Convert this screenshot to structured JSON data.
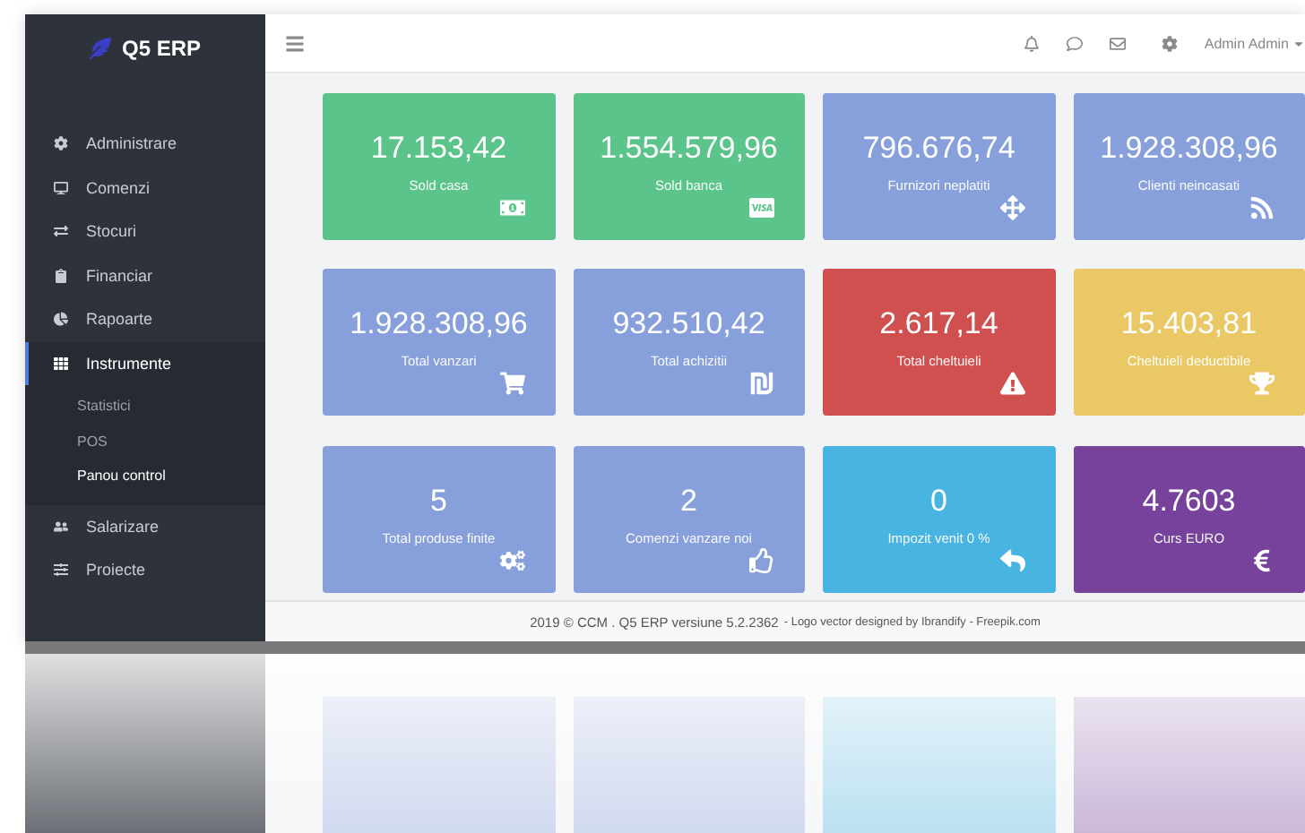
{
  "brand": {
    "name": "Q5 ERP"
  },
  "sidebar": {
    "items": [
      {
        "label": "Administrare",
        "selected": false
      },
      {
        "label": "Comenzi",
        "selected": false
      },
      {
        "label": "Stocuri",
        "selected": false
      },
      {
        "label": "Financiar",
        "selected": false
      },
      {
        "label": "Rapoarte",
        "selected": false
      },
      {
        "label": "Instrumente",
        "selected": true,
        "expanded": true,
        "children": [
          {
            "label": "Statistici",
            "selected": false
          },
          {
            "label": "POS",
            "selected": false
          },
          {
            "label": "Panou control",
            "selected": true
          }
        ]
      },
      {
        "label": "Salarizare",
        "selected": false
      },
      {
        "label": "Proiecte",
        "selected": false
      }
    ]
  },
  "header": {
    "user": "Admin Admin"
  },
  "cards": [
    {
      "value": "17.153,42",
      "label": "Sold casa",
      "color": "#5bc48a"
    },
    {
      "value": "1.554.579,96",
      "label": "Sold banca",
      "color": "#5bc48a"
    },
    {
      "value": "796.676,74",
      "label": "Furnizori neplatiti",
      "color": "#87a0dc"
    },
    {
      "value": "1.928.308,96",
      "label": "Clienti neincasati",
      "color": "#87a0dc"
    },
    {
      "value": "1.928.308,96",
      "label": "Total vanzari",
      "color": "#87a0dc"
    },
    {
      "value": "932.510,42",
      "label": "Total achizitii",
      "color": "#87a0dc"
    },
    {
      "value": "2.617,14",
      "label": "Total cheltuieli",
      "color": "#d05050"
    },
    {
      "value": "15.403,81",
      "label": "Cheltuieli deductibile",
      "color": "#eac865"
    },
    {
      "value": "5",
      "label": "Total produse finite",
      "color": "#87a0dc"
    },
    {
      "value": "2",
      "label": "Comenzi vanzare noi",
      "color": "#87a0dc"
    },
    {
      "value": "0",
      "label": "Impozit venit 0 %",
      "color": "#48b4e2"
    },
    {
      "value": "4.7603",
      "label": "Curs EURO",
      "color": "#76429c"
    }
  ],
  "footer": {
    "text": "2019 © CCM . Q5 ERP versiune 5.2.2362",
    "credit": "- Logo vector designed by Ibrandify - Freepik.com"
  }
}
